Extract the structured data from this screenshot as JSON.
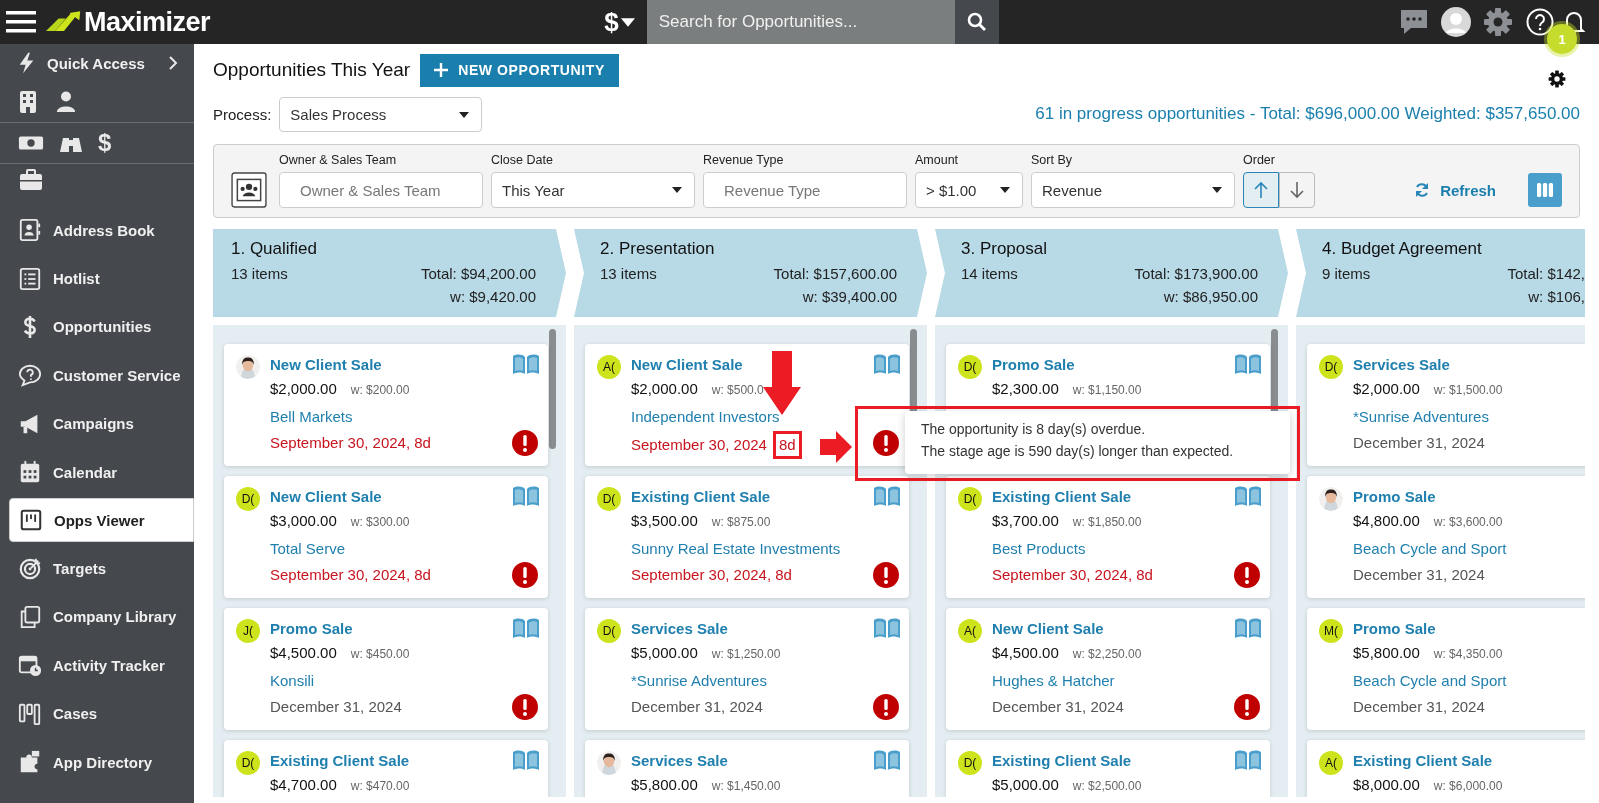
{
  "topbar": {
    "brand": "Maximizer",
    "currency_symbol": "$",
    "search": {
      "placeholder": "Search for Opportunities..."
    },
    "notification_count": "1"
  },
  "sidebar": {
    "quick_access": "Quick Access",
    "items": [
      {
        "label": "Address Book",
        "selected": false
      },
      {
        "label": "Hotlist",
        "selected": false
      },
      {
        "label": "Opportunities",
        "selected": false
      },
      {
        "label": "Customer Service",
        "selected": false
      },
      {
        "label": "Campaigns",
        "selected": false
      },
      {
        "label": "Calendar",
        "selected": false
      },
      {
        "label": "Opps Viewer",
        "selected": true
      },
      {
        "label": "Targets",
        "selected": false
      },
      {
        "label": "Company Library",
        "selected": false
      },
      {
        "label": "Activity Tracker",
        "selected": false
      },
      {
        "label": "Cases",
        "selected": false
      },
      {
        "label": "App Directory",
        "selected": false
      }
    ]
  },
  "page": {
    "title": "Opportunities This Year",
    "new_button": "NEW OPPORTUNITY",
    "process_label": "Process:",
    "process_value": "Sales Process",
    "summary": "61 in progress opportunities - Total: $696,000.00 Weighted: $357,650.00"
  },
  "filters": [
    {
      "label": "Owner & Sales Team",
      "kind": "text",
      "placeholder": "Owner & Sales Team"
    },
    {
      "label": "Close Date",
      "kind": "select",
      "value": "This Year"
    },
    {
      "label": "Revenue Type",
      "kind": "text",
      "placeholder": "Revenue Type"
    },
    {
      "label": "Amount",
      "kind": "select",
      "value": "> $1.00"
    },
    {
      "label": "Sort By",
      "kind": "select",
      "value": "Revenue"
    }
  ],
  "order": {
    "label": "Order",
    "buttons": [
      {
        "selected": true
      },
      {
        "selected": false
      }
    ]
  },
  "refresh": "Refresh",
  "stages": [
    {
      "name": "1. Qualified",
      "count": "13 items",
      "total": "Total: $94,200.00",
      "weighted": "w: $9,420.00",
      "cards": [
        {
          "title": "New Client Sale",
          "amount": "$2,000.00",
          "weighted": "w: $200.00",
          "company": "Bell Markets",
          "date": "September 30, 2024, 8d",
          "overdue": true,
          "alert": true
        },
        {
          "title": "New Client Sale",
          "avatar": {
            "kind": "initials",
            "text": "D("
          },
          "amount": "$3,000.00",
          "weighted": "w: $300.00",
          "company": "Total Serve",
          "date": "September 30, 2024, 8d",
          "overdue": true,
          "alert": true
        },
        {
          "title": "Promo Sale",
          "avatar": {
            "kind": "initials",
            "text": "J("
          },
          "amount": "$4,500.00",
          "weighted": "w: $450.00",
          "company": "Konsili",
          "date": "December 31, 2024",
          "overdue": false,
          "alert": true
        },
        {
          "title": "Existing Client Sale",
          "avatar": {
            "kind": "initials",
            "text": "D("
          },
          "amount": "$4,700.00",
          "weighted": "w: $470.00"
        }
      ]
    },
    {
      "name": "2. Presentation",
      "count": "13 items",
      "total": "Total: $157,600.00",
      "weighted": "w: $39,400.00",
      "cards": [
        {
          "title": "New Client Sale",
          "avatar": {
            "kind": "initials",
            "text": "A("
          },
          "amount": "$2,000.00",
          "weighted": "w: $500.0",
          "company": "Independent Investors",
          "date": "September 30, 2024",
          "age": "8d",
          "overdue": true,
          "alert": true
        },
        {
          "title": "Existing Client Sale",
          "avatar": {
            "kind": "initials",
            "text": "D("
          },
          "amount": "$3,500.00",
          "weighted": "w: $875.00",
          "company": "Sunny Real Estate Investments",
          "date": "September 30, 2024, 8d",
          "overdue": true,
          "alert": true
        },
        {
          "title": "Services Sale",
          "avatar": {
            "kind": "initials",
            "text": "D("
          },
          "amount": "$5,000.00",
          "weighted": "w: $1,250.00",
          "company": "*Sunrise Adventures",
          "date": "December 31, 2024",
          "overdue": false,
          "alert": true
        },
        {
          "title": "Services Sale",
          "amount": "$5,800.00",
          "weighted": "w: $1,450.00"
        }
      ]
    },
    {
      "name": "3. Proposal",
      "count": "14 items",
      "total": "Total: $173,900.00",
      "weighted": "w: $86,950.00",
      "cards": [
        {
          "title": "Promo Sale",
          "avatar": {
            "kind": "initials",
            "text": "D("
          },
          "amount": "$2,300.00",
          "weighted": "w: $1,150.00"
        },
        {
          "title": "Existing Client Sale",
          "avatar": {
            "kind": "initials",
            "text": "D("
          },
          "amount": "$3,700.00",
          "weighted": "w: $1,850.00",
          "company": "Best Products",
          "date": "September 30, 2024, 8d",
          "overdue": true,
          "alert": true
        },
        {
          "title": "New Client Sale",
          "avatar": {
            "kind": "initials",
            "text": "A("
          },
          "amount": "$4,500.00",
          "weighted": "w: $2,250.00",
          "company": "Hughes & Hatcher",
          "date": "December 31, 2024",
          "overdue": false,
          "alert": true
        },
        {
          "title": "Existing Client Sale",
          "avatar": {
            "kind": "initials",
            "text": "D("
          },
          "amount": "$5,000.00",
          "weighted": "w: $2,500.00"
        }
      ]
    },
    {
      "name": "4. Budget Agreement",
      "count": "9 items",
      "total": "Total: $142,",
      "weighted": "w: $106,",
      "cards": [
        {
          "title": "Services Sale",
          "avatar": {
            "kind": "initials",
            "text": "D("
          },
          "amount": "$2,000.00",
          "weighted": "w: $1,500.00",
          "company": "*Sunrise Adventures",
          "date": "December 31, 2024",
          "overdue": false
        },
        {
          "title": "Promo Sale",
          "amount": "$4,800.00",
          "weighted": "w: $3,600.00",
          "company": "Beach Cycle and Sport",
          "date": "December 31, 2024",
          "overdue": false
        },
        {
          "title": "Promo Sale",
          "avatar": {
            "kind": "initials",
            "text": "M("
          },
          "amount": "$5,800.00",
          "weighted": "w: $4,350.00",
          "company": "Beach Cycle and Sport",
          "date": "December 31, 2024",
          "overdue": false
        },
        {
          "title": "Existing Client Sale",
          "avatar": {
            "kind": "initials",
            "text": "A("
          },
          "amount": "$8,000.00",
          "weighted": "w: $6,000.00"
        }
      ]
    }
  ],
  "tooltip": {
    "lines": [
      "The opportunity is 8 day(s) overdue.",
      "The stage age is 590 day(s) longer than expected."
    ]
  }
}
